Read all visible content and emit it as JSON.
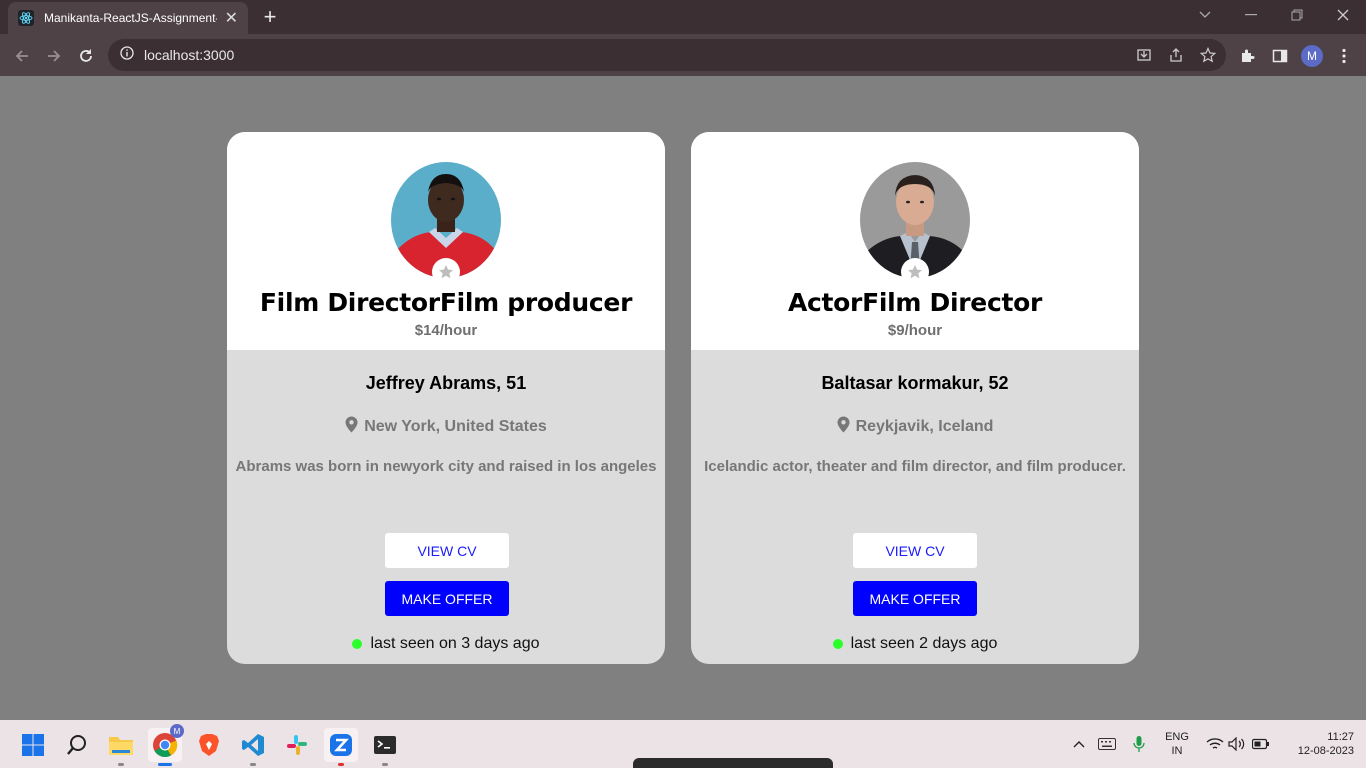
{
  "browser": {
    "tab_title": "Manikanta-ReactJS-Assignment-",
    "url": "localhost:3000",
    "profile_initial": "M"
  },
  "cards": [
    {
      "role": "Film DirectorFilm producer",
      "rate": "$14/hour",
      "name": "Jeffrey Abrams, 51",
      "location": "New York, United States",
      "bio": "Abrams was born in newyork city and raised in los angeles",
      "view_cv_label": "VIEW CV",
      "make_offer_label": "MAKE OFFER",
      "last_seen": "last seen on 3 days ago",
      "status_color": "#2aff2a"
    },
    {
      "role": "ActorFilm Director",
      "rate": "$9/hour",
      "name": "Baltasar kormakur, 52",
      "location": "Reykjavik, Iceland",
      "bio": "Icelandic actor, theater and film director, and film producer.",
      "view_cv_label": "VIEW CV",
      "make_offer_label": "MAKE OFFER",
      "last_seen": "last seen 2 days ago",
      "status_color": "#2aff2a"
    }
  ],
  "taskbar": {
    "language_line1": "ENG",
    "language_line2": "IN",
    "time": "11:27",
    "date": "12-08-2023",
    "chrome_badge": "M"
  },
  "colors": {
    "page_bg": "#808080",
    "offer_button": "#0000ff",
    "view_cv_text": "#1a1aff"
  }
}
